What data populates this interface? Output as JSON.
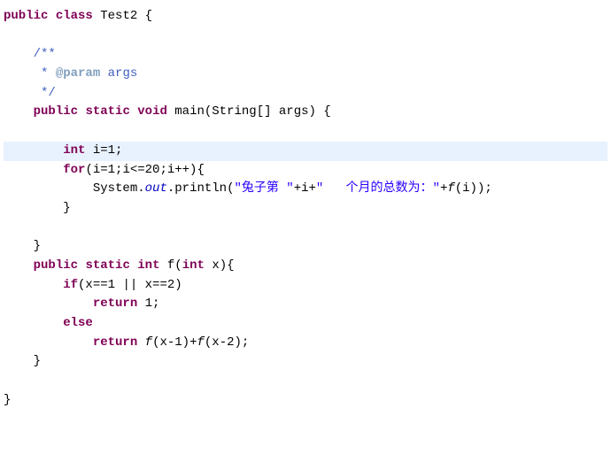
{
  "l1": {
    "kw1": "public",
    "kw2": "class",
    "name": "Test2",
    "brace": " {"
  },
  "l2": {
    "indent": "    ",
    "text": "/**"
  },
  "l3": {
    "indent": "     ",
    "star": "* ",
    "tag": "@param",
    "rest": " args"
  },
  "l4": {
    "indent": "     ",
    "text": "*/"
  },
  "l5": {
    "indent": "    ",
    "kw1": "public",
    "kw2": "static",
    "kw3": "void",
    "method": " main(String[] args) {"
  },
  "l6": {
    "indent": "        ",
    "kw": "int",
    "rest": " i=1;"
  },
  "l7": {
    "indent": "        ",
    "kw": "for",
    "rest": "(i=1;i<=20;i++){"
  },
  "l8": {
    "indent": "            ",
    "sys": "System.",
    "out": "out",
    "print": ".println(",
    "str1": "\"兔子第 \"",
    "plus1": "+i+",
    "str2": "\"   个月的总数为：\"",
    "plus2": "+",
    "call": "f",
    "args": "(i));"
  },
  "l9": {
    "indent": "        ",
    "text": "}"
  },
  "l10": {
    "indent": "    ",
    "text": "}"
  },
  "l11": {
    "indent": "    ",
    "kw1": "public",
    "kw2": "static",
    "kw3": "int",
    "method": " f(",
    "kw4": "int",
    "rest": " x){"
  },
  "l12": {
    "indent": "        ",
    "kw": "if",
    "rest": "(x==1 || x==2)"
  },
  "l13": {
    "indent": "            ",
    "kw": "return",
    "rest": " 1;"
  },
  "l14": {
    "indent": "        ",
    "kw": "else"
  },
  "l15": {
    "indent": "            ",
    "kw": "return",
    "rest": " ",
    "call1": "f",
    "args1": "(x-1)+",
    "call2": "f",
    "args2": "(x-2);"
  },
  "l16": {
    "indent": "    ",
    "text": "}"
  },
  "l17": {
    "text": "}"
  }
}
